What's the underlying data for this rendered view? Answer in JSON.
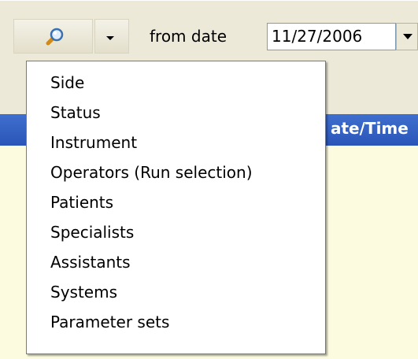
{
  "toolbar": {
    "search_icon": "search-icon",
    "dropdown_icon": "chevron-down-icon",
    "from_label": "from date",
    "date_value": "11/27/2006"
  },
  "grid": {
    "header_partial": "ate/Time"
  },
  "menu": {
    "items": [
      {
        "label": "Side"
      },
      {
        "label": "Status"
      },
      {
        "label": "Instrument"
      },
      {
        "label": "Operators (Run selection)"
      },
      {
        "label": "Patients"
      },
      {
        "label": "Specialists"
      },
      {
        "label": "Assistants"
      },
      {
        "label": "Systems"
      },
      {
        "label": "Parameter sets"
      }
    ]
  },
  "colors": {
    "toolbar_bg": "#ece9d8",
    "header_blue": "#2a55b8",
    "grid_body": "#fcfbe0",
    "menu_bg": "#ffffff"
  }
}
